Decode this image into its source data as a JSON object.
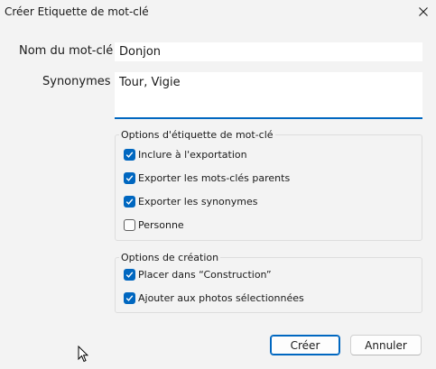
{
  "window": {
    "title": "Créer Etiquette de mot-clé"
  },
  "form": {
    "name_label": "Nom du mot-clé :",
    "name_value": "Donjon",
    "synonyms_label": "Synonymes :",
    "synonyms_value": "Tour, Vigie"
  },
  "tag_options": {
    "title": "Options d'étiquette de mot-clé",
    "items": [
      {
        "label": "Inclure à l'exportation",
        "checked": true
      },
      {
        "label": "Exporter les mots-clés parents",
        "checked": true
      },
      {
        "label": "Exporter les synonymes",
        "checked": true
      },
      {
        "label": "Personne",
        "checked": false
      }
    ]
  },
  "creation_options": {
    "title": "Options de création",
    "items": [
      {
        "label": "Placer dans “Construction”",
        "checked": true
      },
      {
        "label": "Ajouter aux photos sélectionnées",
        "checked": true
      }
    ]
  },
  "buttons": {
    "create": "Créer",
    "cancel": "Annuler"
  },
  "colors": {
    "accent": "#0067c0",
    "background": "#f3f3f3"
  }
}
